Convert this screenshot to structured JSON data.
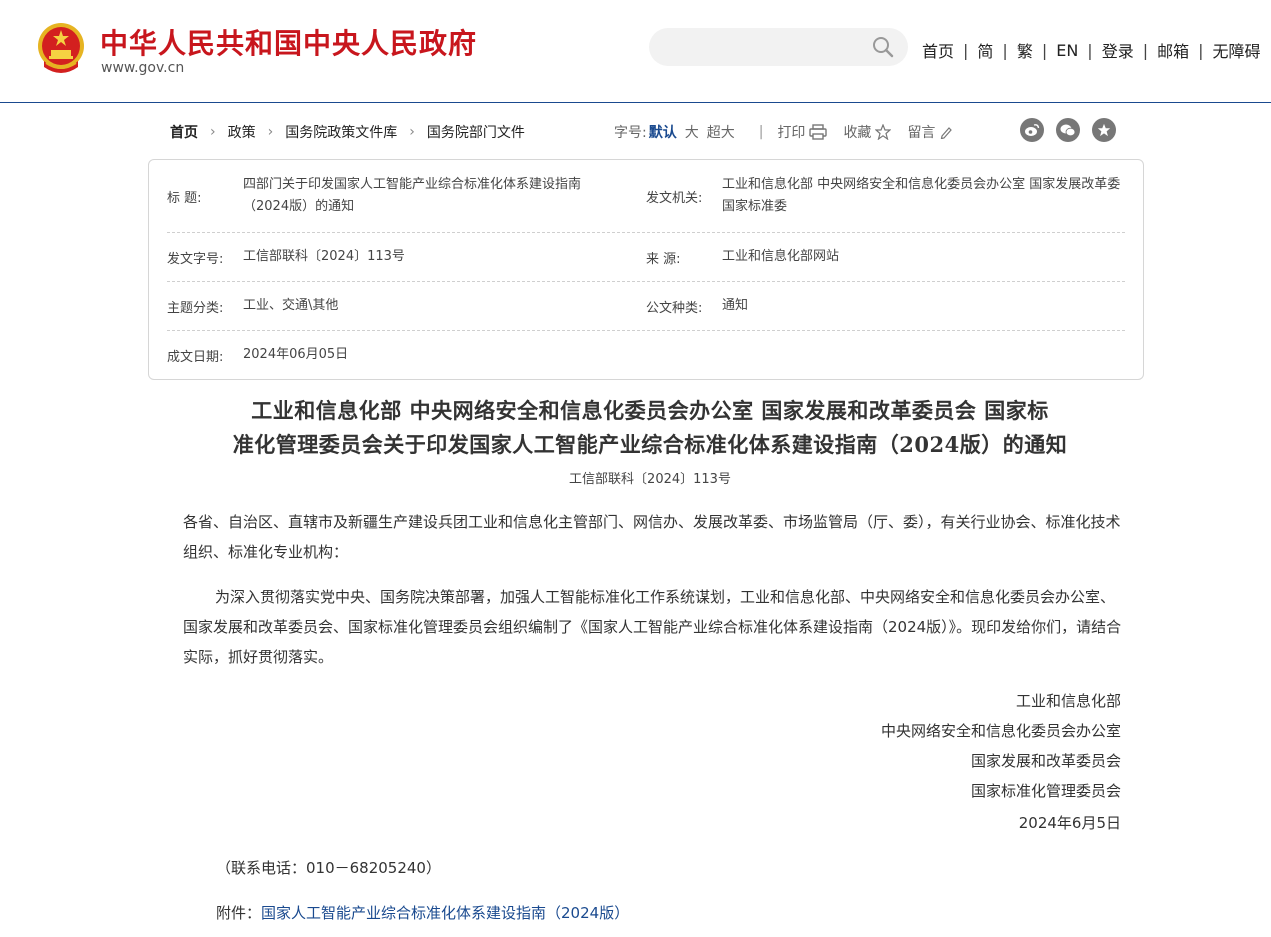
{
  "header": {
    "site_title": "中华人民共和国中央人民政府",
    "site_domain": "www.gov.cn",
    "search": {
      "placeholder": "",
      "value": ""
    },
    "nav": [
      "首页",
      "简",
      "繁",
      "EN",
      "登录",
      "邮箱",
      "无障碍"
    ]
  },
  "breadcrumb": [
    "首页",
    "政策",
    "国务院政策文件库",
    "国务院部门文件"
  ],
  "toolbar": {
    "font_label": "字号:",
    "font_default": "默认",
    "font_large": "大",
    "font_xlarge": "超大",
    "print": "打印",
    "favorite": "收藏",
    "comment": "留言"
  },
  "meta": {
    "title_label": "标 题:",
    "title_value": "四部门关于印发国家人工智能产业综合标准化体系建设指南（2024版）的通知",
    "issuer_label": "发文机关:",
    "issuer_value": "工业和信息化部 中央网络安全和信息化委员会办公室 国家发展改革委 国家标准委",
    "docno_label": "发文字号:",
    "docno_value": "工信部联科〔2024〕113号",
    "source_label": "来 源:",
    "source_value": "工业和信息化部网站",
    "topic_label": "主题分类:",
    "topic_value": "工业、交通\\其他",
    "type_label": "公文种类:",
    "type_value": "通知",
    "date_label": "成文日期:",
    "date_value": "2024年06月05日"
  },
  "article": {
    "title_line1": "工业和信息化部 中央网络安全和信息化委员会办公室 国家发展和改革委员会 国家标",
    "title_line2": "准化管理委员会关于印发国家人工智能产业综合标准化体系建设指南（2024版）的通知",
    "doc_number": "工信部联科〔2024〕113号",
    "salutation": "各省、自治区、直辖市及新疆生产建设兵团工业和信息化主管部门、网信办、发展改革委、市场监管局（厅、委），有关行业协会、标准化技术组织、标准化专业机构：",
    "body": "为深入贯彻落实党中央、国务院决策部署，加强人工智能标准化工作系统谋划，工业和信息化部、中央网络安全和信息化委员会办公室、国家发展和改革委员会、国家标准化管理委员会组织编制了《国家人工智能产业综合标准化体系建设指南（2024版）》。现印发给你们，请结合实际，抓好贯彻落实。",
    "signatories": [
      "工业和信息化部",
      "中央网络安全和信息化委员会办公室",
      "国家发展和改革委员会",
      "国家标准化管理委员会"
    ],
    "sign_date": "2024年6月5日",
    "contact": "（联系电话：010－68205240）",
    "attachment_label": "附件：",
    "attachment_link": "国家人工智能产业综合标准化体系建设指南（2024版）"
  },
  "colors": {
    "brand_red": "#c8161d",
    "link_blue": "#1a4a8f"
  }
}
